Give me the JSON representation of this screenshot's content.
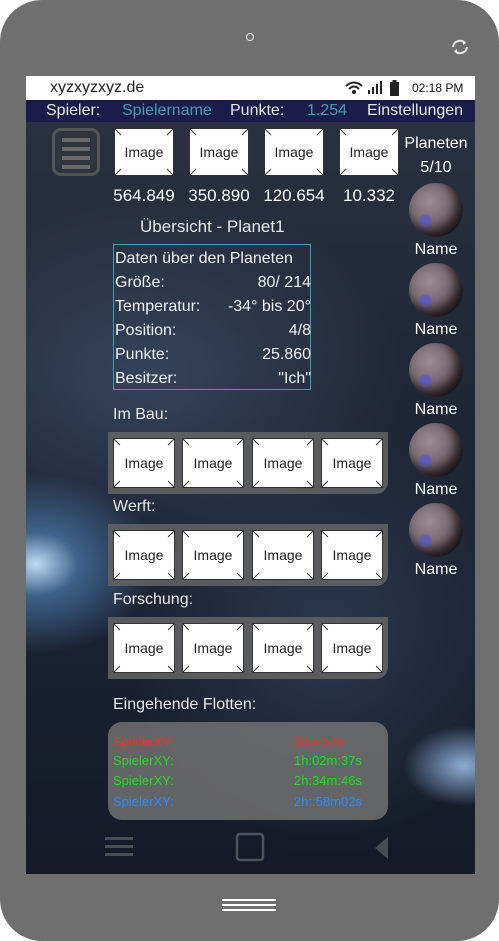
{
  "statusbar": {
    "title": "xyzxyzxyz.de",
    "time": "02:18 PM"
  },
  "topbar": {
    "player_label": "Spieler:",
    "player_name": "Spielername",
    "points_label": "Punkte:",
    "points_value": "1.254",
    "settings": "Einstellungen",
    "colors": {
      "background": "#1c1c4a",
      "accent": "#3aa0b0"
    }
  },
  "resources": {
    "image_label": "Image",
    "values": [
      "564.849",
      "350.890",
      "120.654",
      "10.332"
    ]
  },
  "overview_title": "Übersicht - Planet1",
  "planet_info": {
    "heading": "Daten über den Planeten",
    "rows": [
      {
        "label": "Größe:",
        "value": "80/ 214"
      },
      {
        "label": "Temperatur:",
        "value": "-34° bis 20°"
      },
      {
        "label": "Position:",
        "value": "4/8"
      },
      {
        "label": "Punkte:",
        "value": "25.860"
      },
      {
        "label": "Besitzer:",
        "value": "\"Ich\""
      }
    ]
  },
  "sections": {
    "construction": {
      "label": "Im Bau:",
      "items": [
        "Image",
        "Image",
        "Image",
        "Image"
      ]
    },
    "shipyard": {
      "label": "Werft:",
      "items": [
        "Image",
        "Image",
        "Image",
        "Image"
      ]
    },
    "research": {
      "label": "Forschung:",
      "items": [
        "Image",
        "Image",
        "Image",
        "Image"
      ]
    }
  },
  "fleets": {
    "label": "Eingehende Flotten:",
    "rows": [
      {
        "player": "SpielerXY:",
        "time": "20m:54s",
        "color": "#ff2a2a"
      },
      {
        "player": "SpielerXY:",
        "time": "1h:02m:37s",
        "color": "#22dd22"
      },
      {
        "player": "SpielerXY:",
        "time": "2h:34m:46s",
        "color": "#22dd22"
      },
      {
        "player": "SpielerXY:",
        "time": "2h::58m02s",
        "color": "#2a8cff"
      }
    ]
  },
  "planets": {
    "title": "Planeten",
    "count": "5/10",
    "names": [
      "Name",
      "Name",
      "Name",
      "Name",
      "Name"
    ]
  },
  "icons": [
    "camera-icon",
    "rotate-icon",
    "wifi-icon",
    "signal-icon",
    "battery-icon",
    "menu-icon",
    "back-icon",
    "home-icon",
    "hamburger-softkey-icon",
    "home-bars-icon"
  ]
}
